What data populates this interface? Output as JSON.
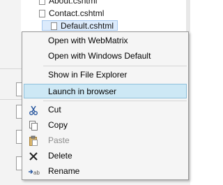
{
  "tree": {
    "items": [
      {
        "label": "About.cshtml"
      },
      {
        "label": "Contact.cshtml"
      },
      {
        "label": "Default.cshtml"
      }
    ]
  },
  "context_menu": {
    "items": [
      {
        "label": "Open with WebMatrix",
        "icon": null,
        "state": "normal"
      },
      {
        "label": "Open with Windows Default",
        "icon": null,
        "state": "normal"
      },
      {
        "label": "Show in File Explorer",
        "icon": null,
        "state": "normal"
      },
      {
        "label": "Launch in browser",
        "icon": null,
        "state": "highlighted"
      },
      {
        "label": "Cut",
        "icon": "scissors-icon",
        "state": "normal"
      },
      {
        "label": "Copy",
        "icon": "copy-icon",
        "state": "normal"
      },
      {
        "label": "Paste",
        "icon": "paste-icon",
        "state": "disabled"
      },
      {
        "label": "Delete",
        "icon": "delete-icon",
        "state": "normal"
      },
      {
        "label": "Rename",
        "icon": "rename-icon",
        "state": "normal"
      }
    ]
  },
  "colors": {
    "highlight": "#cde8f5",
    "highlight_border": "#8fc0db",
    "menu_bg": "#f5f5f5",
    "selection": "#dcebfc"
  }
}
